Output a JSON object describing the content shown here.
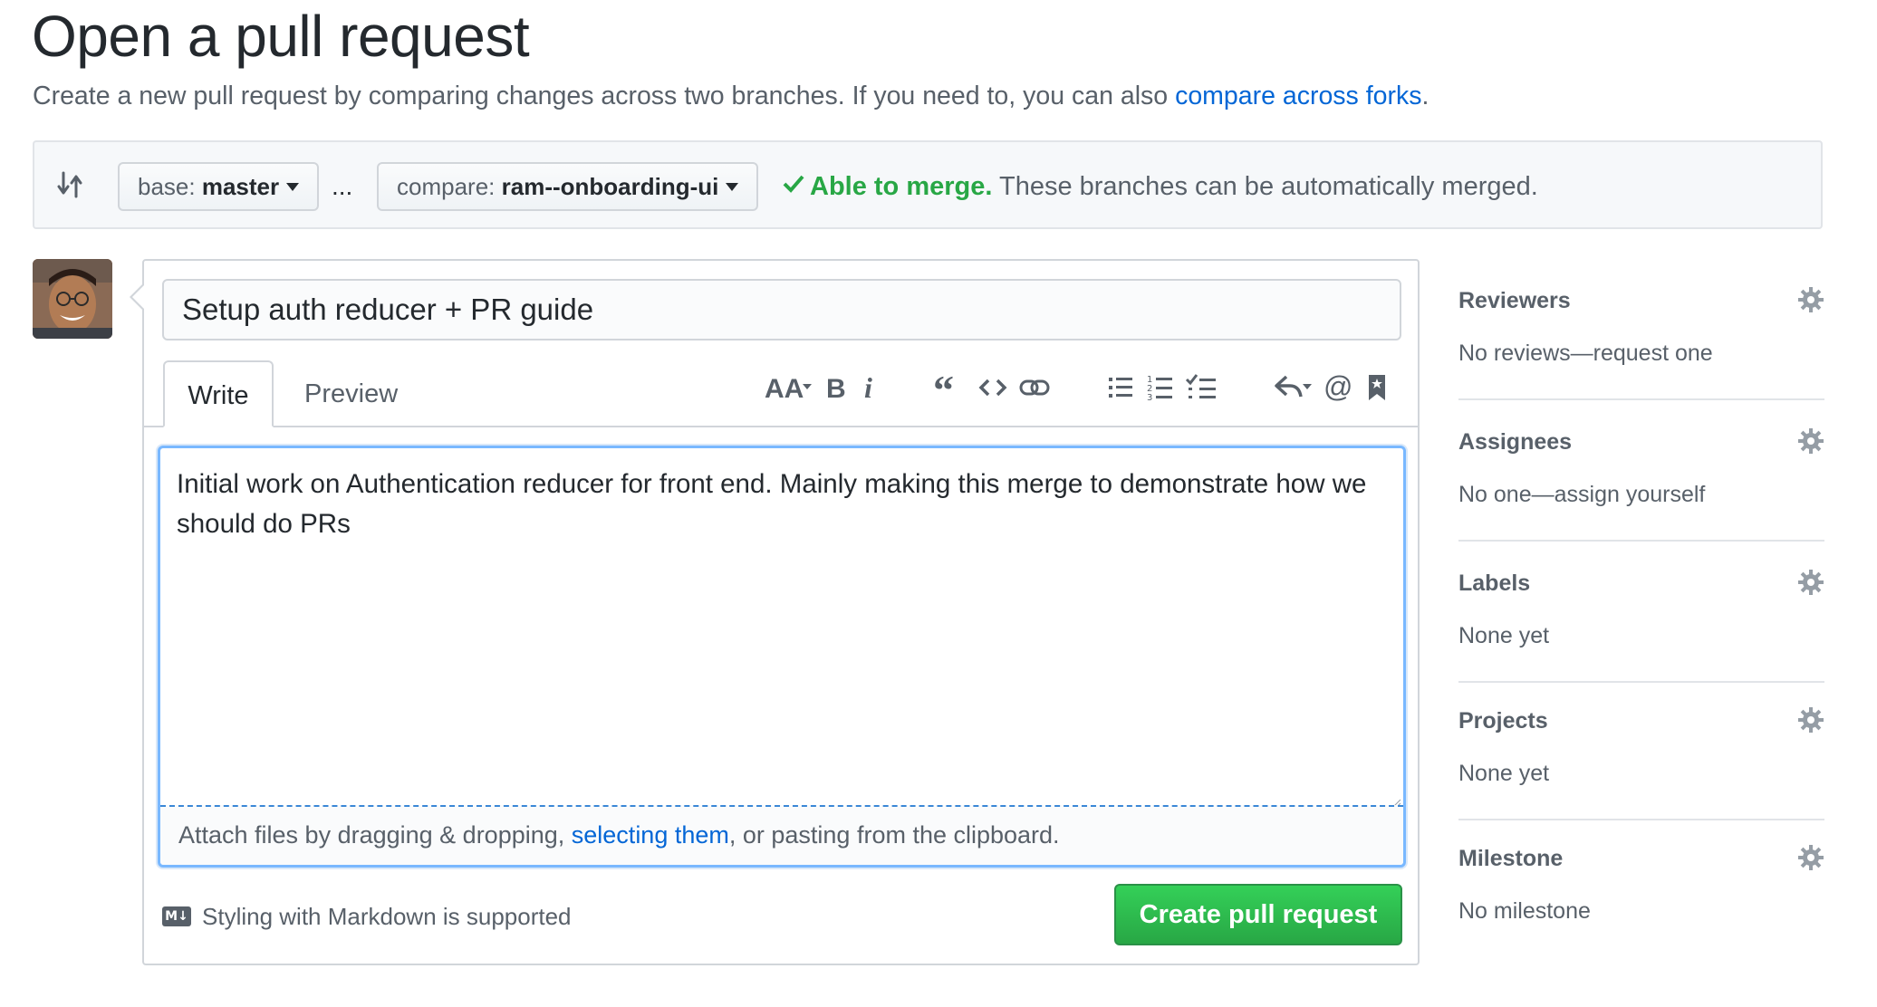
{
  "header": {
    "title": "Open a pull request",
    "subtitle_text": "Create a new pull request by comparing changes across two branches. If you need to, you can also",
    "subtitle_link": "compare across forks",
    "subtitle_end": "."
  },
  "range": {
    "base_prefix": "base:",
    "base_branch": "master",
    "ellipsis": "...",
    "compare_prefix": "compare:",
    "compare_branch": "ram--onboarding-ui",
    "merge_ok": "Able to merge.",
    "merge_detail": "These branches can be automatically merged."
  },
  "composer": {
    "title_value": "Setup auth reducer + PR guide",
    "tabs": [
      {
        "label": "Write"
      },
      {
        "label": "Preview"
      }
    ],
    "body_value": "Initial work on Authentication reducer for front end. Mainly making this merge to demonstrate how we should do PRs",
    "attach_prefix": "Attach files by dragging & dropping,",
    "attach_link": "selecting them",
    "attach_suffix": ", or pasting from the clipboard.",
    "markdown_hint": "Styling with Markdown is supported",
    "markdown_badge": "M↓",
    "submit_label": "Create pull request"
  },
  "toolbar": {
    "icons": [
      "text-size-icon",
      "bold-icon",
      "italic-icon",
      "quote-icon",
      "code-icon",
      "link-icon",
      "unordered-list-icon",
      "ordered-list-icon",
      "task-list-icon",
      "reply-icon",
      "mention-icon",
      "bookmark-icon"
    ]
  },
  "sidebar": {
    "sections": [
      {
        "title": "Reviewers",
        "value": "No reviews—request one"
      },
      {
        "title": "Assignees",
        "value": "No one—assign yourself"
      },
      {
        "title": "Labels",
        "value": "None yet"
      },
      {
        "title": "Projects",
        "value": "None yet"
      },
      {
        "title": "Milestone",
        "value": "No milestone"
      }
    ]
  },
  "colors": {
    "link": "#0366d6",
    "success": "#28a745",
    "focus_border": "#79b8ff"
  }
}
